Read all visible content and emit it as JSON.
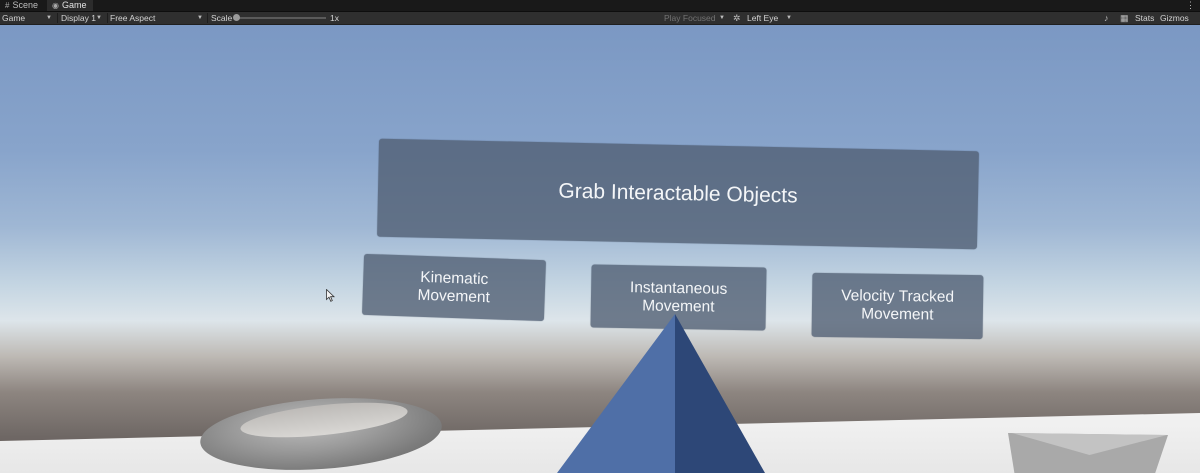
{
  "tabs": [
    {
      "label": "Scene",
      "icon": "grid-icon"
    },
    {
      "label": "Game",
      "icon": "gamepad-icon"
    }
  ],
  "toolbar": {
    "view_mode": "Game",
    "display": "Display 1",
    "aspect": "Free Aspect",
    "scale_label": "Scale",
    "scale_value": "1x",
    "play_mode": "Play Focused",
    "eye": "Left Eye",
    "stats": "Stats",
    "gizmos": "Gizmos"
  },
  "scene": {
    "title_panel": "Grab Interactable Objects",
    "buttons": [
      {
        "line1": "Kinematic",
        "line2": "Movement"
      },
      {
        "line1": "Instantaneous",
        "line2": "Movement"
      },
      {
        "line1": "Velocity Tracked",
        "line2": "Movement"
      }
    ]
  },
  "colors": {
    "panel": "#505d72",
    "pyramid_light": "#4f6fa7",
    "pyramid_dark": "#2d4777",
    "sky_top": "#7b98c3"
  }
}
